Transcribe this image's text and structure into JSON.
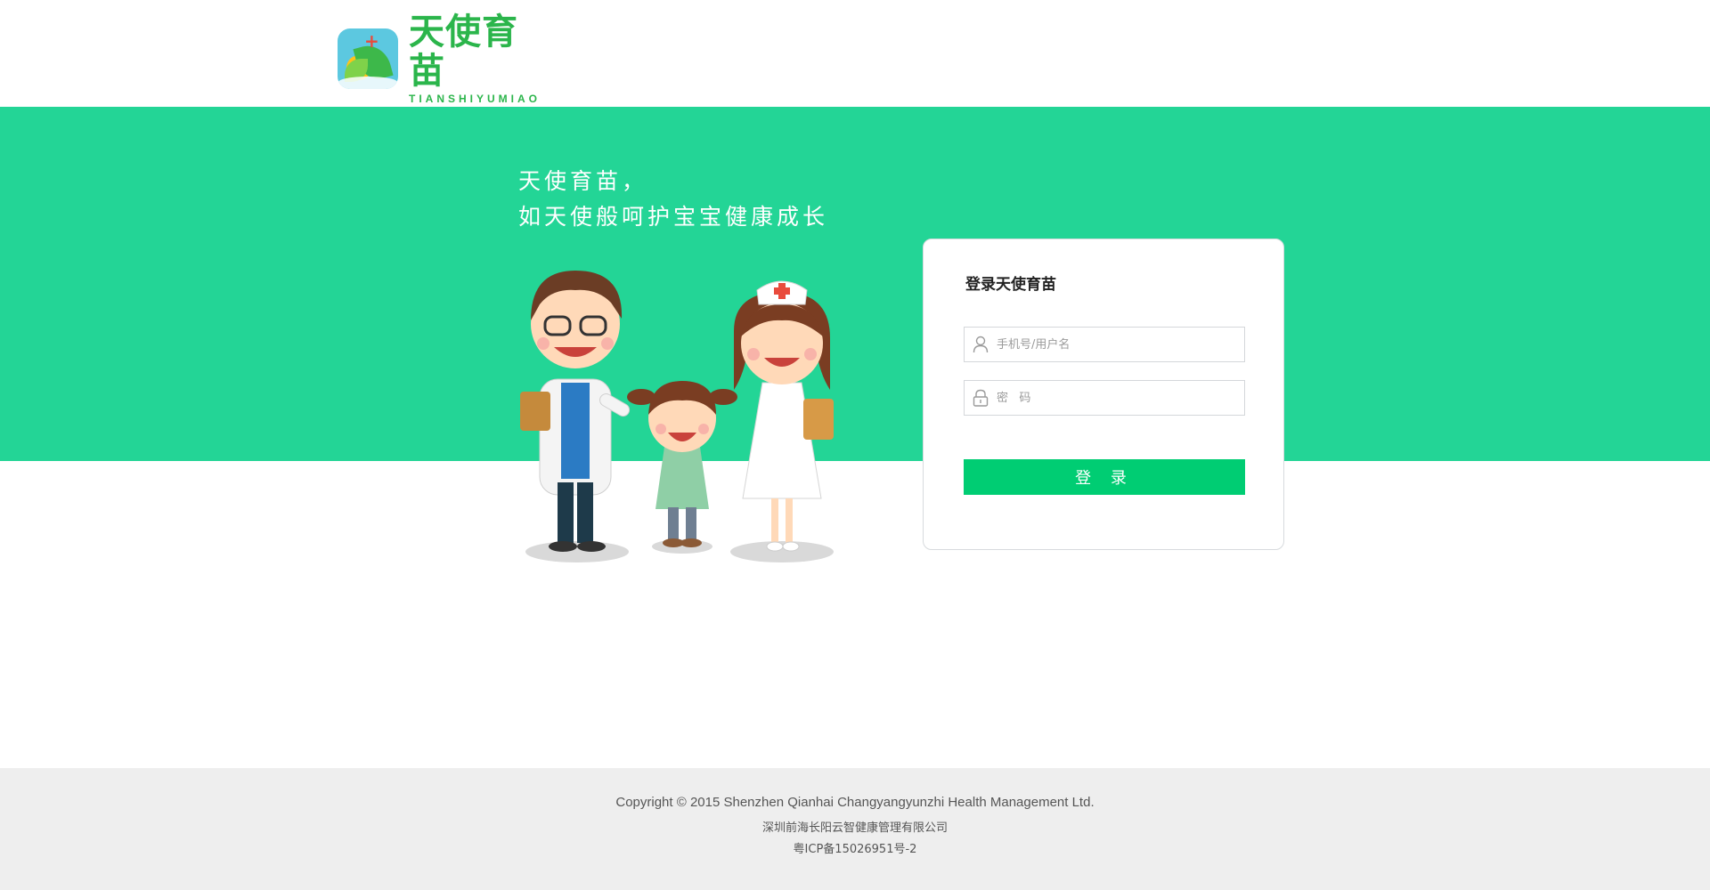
{
  "header": {
    "logo_cn": "天使育苗",
    "logo_en": "TIANSHIYUMIAO",
    "logo_cross": "+"
  },
  "hero": {
    "slogan_line1": "天使育苗，",
    "slogan_line2": "如天使般呵护宝宝健康成长"
  },
  "login": {
    "title": "登录天使育苗",
    "username_placeholder": "手机号/用户名",
    "password_placeholder": "密   码",
    "submit_label": "登 录"
  },
  "footer": {
    "copyright": "Copyright © 2015 Shenzhen Qianhai Changyangyunzhi Health Management Ltd.",
    "company": "深圳前海长阳云智健康管理有限公司",
    "icp": "粤ICP备15026951号-2"
  },
  "colors": {
    "brand_green": "#23d596",
    "button_green": "#00cd73",
    "logo_green": "#2bb54b",
    "footer_bg": "#eeeeee"
  },
  "icons": [
    "user-icon",
    "lock-icon"
  ]
}
